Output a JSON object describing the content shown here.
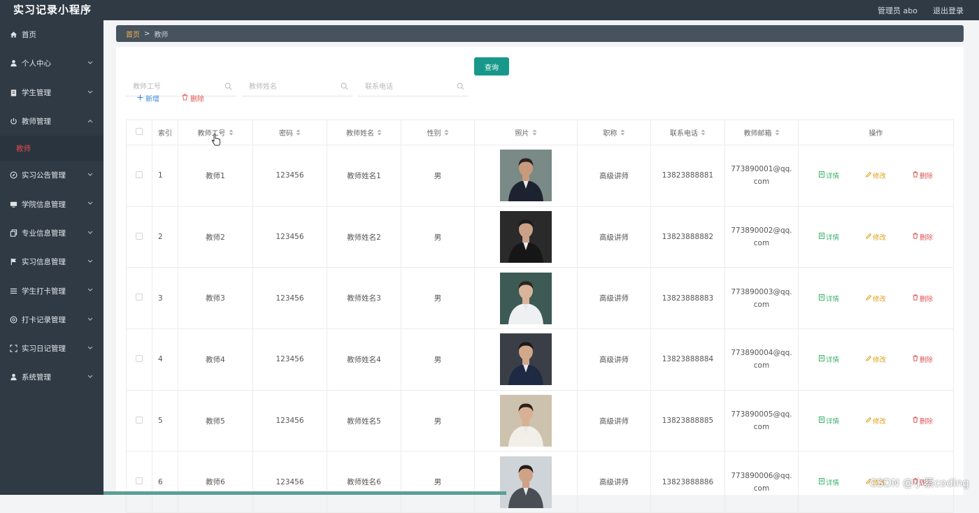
{
  "app": {
    "title": "实习记录小程序",
    "user": "管理员 abo",
    "logout": "退出登录"
  },
  "sidebar": {
    "items": [
      {
        "label": "首页",
        "icon": "home-icon"
      },
      {
        "label": "个人中心",
        "icon": "user-icon"
      },
      {
        "label": "学生管理",
        "icon": "clipboard-icon"
      },
      {
        "label": "教师管理",
        "icon": "power-icon",
        "expanded": true
      },
      {
        "label": "实习公告管理",
        "icon": "compass-icon"
      },
      {
        "label": "学院信息管理",
        "icon": "monitor-icon"
      },
      {
        "label": "专业信息管理",
        "icon": "copy-icon"
      },
      {
        "label": "实习信息管理",
        "icon": "flag-icon"
      },
      {
        "label": "学生打卡管理",
        "icon": "list-icon"
      },
      {
        "label": "打卡记录管理",
        "icon": "aperture-icon"
      },
      {
        "label": "实习日记管理",
        "icon": "scan-icon"
      },
      {
        "label": "系统管理",
        "icon": "user-icon"
      }
    ],
    "sub_item": "教师"
  },
  "breadcrumb": {
    "home": "首页",
    "separator": ">",
    "current": "教师"
  },
  "search": {
    "fields": [
      {
        "placeholder": "教师工号"
      },
      {
        "placeholder": "教师姓名"
      },
      {
        "placeholder": "联系电话"
      }
    ],
    "query_label": "查询"
  },
  "actions": {
    "add_label": "新增",
    "delete_label": "删除"
  },
  "table": {
    "headers": [
      "索引",
      "教师工号",
      "密码",
      "教师姓名",
      "性别",
      "照片",
      "职称",
      "联系电话",
      "教师邮箱",
      "操作"
    ],
    "op_labels": {
      "detail": "详情",
      "edit": "修改",
      "remove": "删除"
    },
    "rows": [
      {
        "index": "1",
        "id": "教师1",
        "password": "123456",
        "name": "教师姓名1",
        "gender": "男",
        "title": "高级讲师",
        "phone": "13823888881",
        "email": "773890001@qq.com"
      },
      {
        "index": "2",
        "id": "教师2",
        "password": "123456",
        "name": "教师姓名2",
        "gender": "男",
        "title": "高级讲师",
        "phone": "13823888882",
        "email": "773890002@qq.com"
      },
      {
        "index": "3",
        "id": "教师3",
        "password": "123456",
        "name": "教师姓名3",
        "gender": "男",
        "title": "高级讲师",
        "phone": "13823888883",
        "email": "773890003@qq.com"
      },
      {
        "index": "4",
        "id": "教师4",
        "password": "123456",
        "name": "教师姓名4",
        "gender": "男",
        "title": "高级讲师",
        "phone": "13823888884",
        "email": "773890004@qq.com"
      },
      {
        "index": "5",
        "id": "教师5",
        "password": "123456",
        "name": "教师姓名5",
        "gender": "男",
        "title": "高级讲师",
        "phone": "13823888885",
        "email": "773890005@qq.com"
      },
      {
        "index": "6",
        "id": "教师6",
        "password": "123456",
        "name": "教师姓名6",
        "gender": "男",
        "title": "高级讲师",
        "phone": "13823888886",
        "email": "773890006@qq.com"
      }
    ]
  },
  "watermark": "CSDN @小蔡coding",
  "colors": {
    "sidebar_bg": "#2f3a45",
    "accent": "#17988a",
    "active_sub": "#e04b4b"
  }
}
